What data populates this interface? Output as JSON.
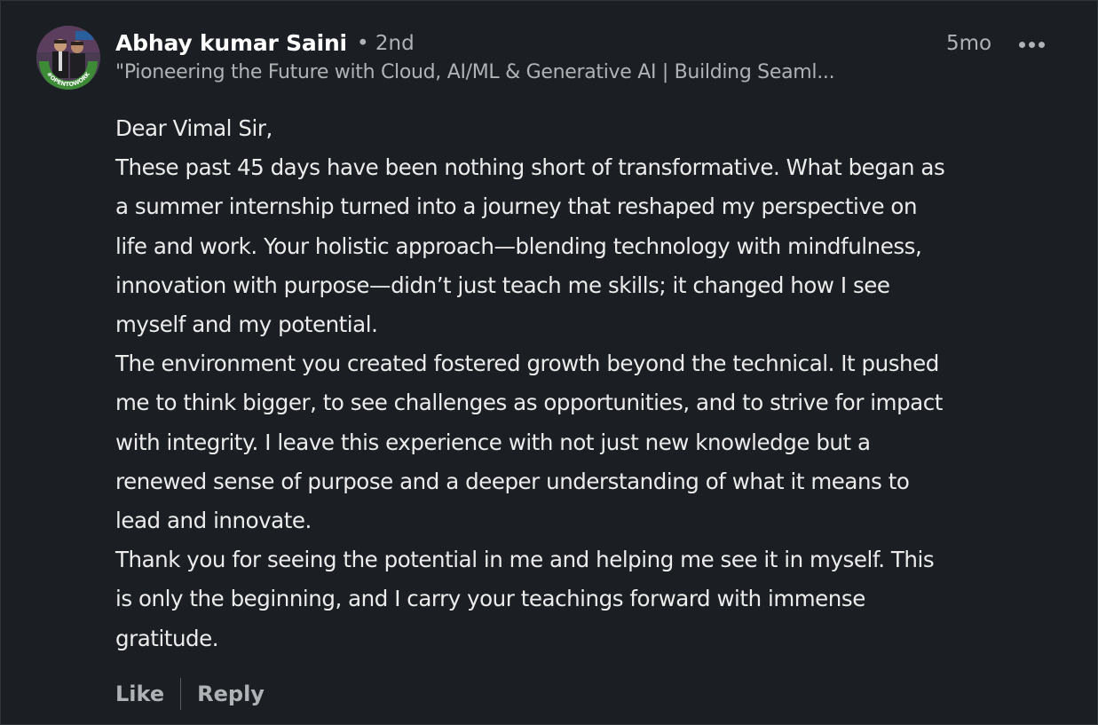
{
  "comment": {
    "author": {
      "name": "Abhay kumar Saini",
      "degree": "• 2nd",
      "headline": "\"Pioneering the Future with Cloud, AI/ML & Generative AI | Building Seaml...",
      "avatar_badge": "#OPENTOWORK"
    },
    "timestamp": "5mo",
    "more_icon": "more-horizontal-icon",
    "lines": [
      "Dear Vimal Sir,",
      "These past 45 days have been nothing short of transformative. What began as",
      "a summer internship turned into a journey that reshaped my perspective on",
      "life and work. Your holistic approach—blending technology with mindfulness,",
      "innovation with purpose—didn’t just teach me skills; it changed how I see",
      "myself and my potential.",
      "The environment you created fostered growth beyond the technical. It pushed",
      "me to think bigger, to see challenges as opportunities, and to strive for impact",
      "with integrity. I leave this experience with not just new knowledge but a",
      "renewed sense of purpose and a deeper understanding of what it means to",
      "lead and innovate.",
      "Thank you for seeing the potential in me and helping me see it in myself. This",
      "is only the beginning, and I carry your teachings forward with immense",
      "gratitude."
    ],
    "actions": {
      "like_label": "Like",
      "reply_label": "Reply"
    }
  },
  "colors": {
    "background": "#1b1f23",
    "primary_text": "#ececec",
    "secondary_text": "#b0b3b6",
    "badge_green": "#3d8b37"
  }
}
